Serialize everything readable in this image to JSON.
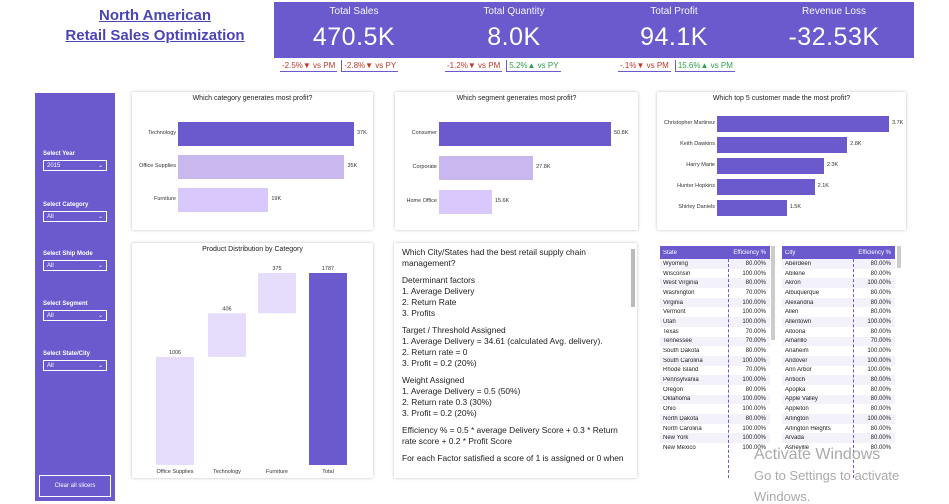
{
  "title": {
    "line1": "North American",
    "line2": "Retail Sales Optimization"
  },
  "kpis": [
    {
      "label": "Total Sales",
      "value": "470.5K"
    },
    {
      "label": "Total Quantity",
      "value": "8.0K"
    },
    {
      "label": "Total Profit",
      "value": "94.1K"
    },
    {
      "label": "Revenue Loss",
      "value": "-32.53K"
    }
  ],
  "kpi_changes": {
    "sales": [
      "-2.5%▼ vs PM",
      "-2.8%▼ vs PY"
    ],
    "quantity": [
      "-1.2%▼ vs PM",
      "5.2%▲ vs PY"
    ],
    "profit": [
      "-.1%▼ vs PM",
      "15.6%▲ vs PM"
    ]
  },
  "slicers": [
    {
      "label": "Select Year",
      "value": "2015"
    },
    {
      "label": "Select Category",
      "value": "All"
    },
    {
      "label": "Select Ship Mode",
      "value": "All"
    },
    {
      "label": "Select Segment",
      "value": "All"
    },
    {
      "label": "Select State/City",
      "value": "All"
    }
  ],
  "clear_button": "Clear all slicers",
  "chart_data": [
    {
      "type": "bar",
      "title": "Which category generates most profit?",
      "categories": [
        "Technology",
        "Office Supplies",
        "Furniture"
      ],
      "values": [
        37,
        35,
        19
      ],
      "labels": [
        "37K",
        "35K",
        "19K"
      ],
      "colors": [
        "#6a5acd",
        "#c9b8f0",
        "#d9c8fa"
      ]
    },
    {
      "type": "bar",
      "title": "Which segment generates most profit?",
      "categories": [
        "Consumer",
        "Corporate",
        "Home Office"
      ],
      "values": [
        50.8,
        27.8,
        15.6
      ],
      "labels": [
        "50.8K",
        "27.8K",
        "15.6K"
      ],
      "colors": [
        "#6a5acd",
        "#c9b8f0",
        "#d9c8fa"
      ]
    },
    {
      "type": "bar",
      "title": "Which top 5 customer made the most profit?",
      "categories": [
        "Christopher Martinez",
        "Keith Dawkins",
        "Harry Marie",
        "Hunter Hopkins",
        "Shirley Daniels"
      ],
      "values": [
        3.7,
        2.8,
        2.3,
        2.1,
        1.5
      ],
      "labels": [
        "3.7K",
        "2.8K",
        "2.3K",
        "2.1K",
        "1.5K"
      ],
      "colors": [
        "#6a5acd",
        "#6a5acd",
        "#6a5acd",
        "#6a5acd",
        "#6a5acd"
      ]
    },
    {
      "type": "bar",
      "subtype": "waterfall",
      "title": "Product Distribution by Category",
      "categories": [
        "Office Supplies",
        "Technology",
        "Furniture",
        "Total"
      ],
      "values": [
        1006,
        406,
        375,
        1787
      ],
      "labels": [
        "1006",
        "406",
        "375",
        "1787"
      ],
      "colors": [
        "#e6dcfb",
        "#e6dcfb",
        "#e6dcfb",
        "#6a5acd"
      ]
    }
  ],
  "text_panel": {
    "q": "Which City/States had the best retail supply chain management?",
    "det_head": "Determinant factors",
    "det": [
      "1. Average Delivery",
      "2. Return Rate",
      "3. Profits"
    ],
    "target_head": "Target / Threshold Assigned",
    "target": [
      "1. Average Delivery = 34.61 (calculated Avg. delivery).",
      "2. Return rate = 0",
      "3. Profit = 0.2 (20%)"
    ],
    "weight_head": "Weight Assigned",
    "weight": [
      "1. Average Delivery = 0.5 (50%)",
      "2. Return rate 0.3 (30%)",
      "3. Profit = 0.2 (20%)"
    ],
    "formula": "Efficiency % = 0.5 * average Delivery Score + 0.3 * Return rate score + 0.2 * Profit Score",
    "tail": "For each Factor satisfied a score of 1 is assigned or 0 when"
  },
  "state_table": {
    "headers": [
      "State",
      "Efficiency %"
    ],
    "rows": [
      [
        "Wyoming",
        "80.00%"
      ],
      [
        "Wisconsin",
        "100.00%"
      ],
      [
        "West Virginia",
        "80.00%"
      ],
      [
        "Washington",
        "70.00%"
      ],
      [
        "Virginia",
        "100.00%"
      ],
      [
        "Vermont",
        "100.00%"
      ],
      [
        "Utah",
        "100.00%"
      ],
      [
        "Texas",
        "70.00%"
      ],
      [
        "Tennessee",
        "70.00%"
      ],
      [
        "South Dakota",
        "80.00%"
      ],
      [
        "South Carolina",
        "100.00%"
      ],
      [
        "Rhode Island",
        "70.00%"
      ],
      [
        "Pennsylvania",
        "100.00%"
      ],
      [
        "Oregon",
        "80.00%"
      ],
      [
        "Oklahoma",
        "100.00%"
      ],
      [
        "Ohio",
        "100.00%"
      ],
      [
        "North Dakota",
        "80.00%"
      ],
      [
        "North Carolina",
        "100.00%"
      ],
      [
        "New York",
        "100.00%"
      ],
      [
        "New Mexico",
        "100.00%"
      ]
    ]
  },
  "city_table": {
    "headers": [
      "City",
      "Efficiency %"
    ],
    "rows": [
      [
        "Aberdeen",
        "80.00%"
      ],
      [
        "Abilene",
        "80.00%"
      ],
      [
        "Akron",
        "100.00%"
      ],
      [
        "Albuquerque",
        "80.00%"
      ],
      [
        "Alexandria",
        "80.00%"
      ],
      [
        "Allen",
        "80.00%"
      ],
      [
        "Allentown",
        "100.00%"
      ],
      [
        "Altoona",
        "80.00%"
      ],
      [
        "Amarillo",
        "70.00%"
      ],
      [
        "Anaheim",
        "100.00%"
      ],
      [
        "Andover",
        "100.00%"
      ],
      [
        "Ann Arbor",
        "100.00%"
      ],
      [
        "Antioch",
        "80.00%"
      ],
      [
        "Apopka",
        "80.00%"
      ],
      [
        "Apple Valley",
        "80.00%"
      ],
      [
        "Appleton",
        "80.00%"
      ],
      [
        "Arlington",
        "100.00%"
      ],
      [
        "Arlington Heights",
        "80.00%"
      ],
      [
        "Arvada",
        "80.00%"
      ],
      [
        "Asheville",
        "80.00%"
      ]
    ]
  },
  "watermark": {
    "line1": "Activate Windows",
    "line2": "Go to Settings to activate Windows."
  }
}
